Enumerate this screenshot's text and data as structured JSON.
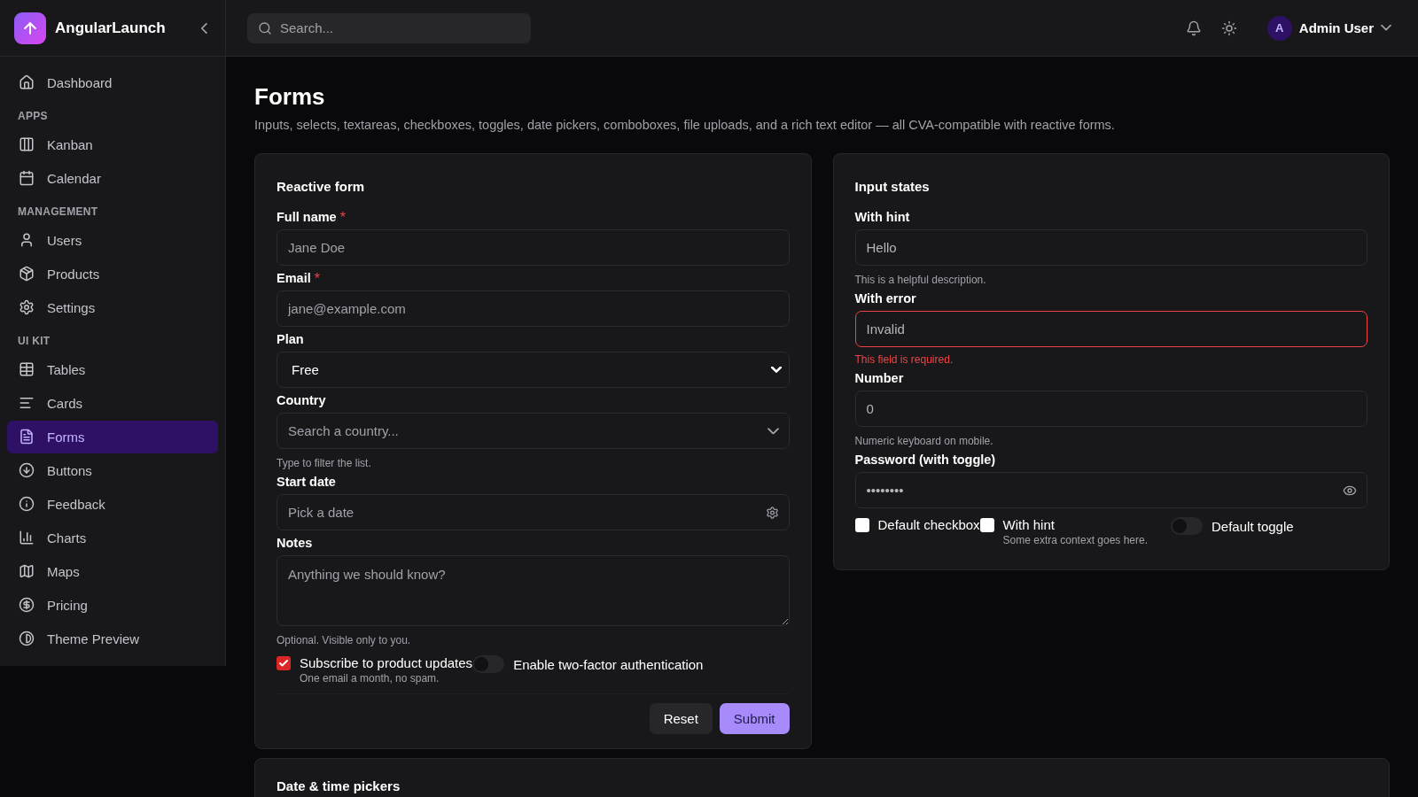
{
  "brand": {
    "name": "AngularLaunch"
  },
  "sidebar": {
    "sections": [
      {
        "items": [
          {
            "label": "Dashboard",
            "selected": false
          }
        ]
      },
      {
        "heading": "APPS",
        "items": [
          {
            "label": "Kanban",
            "selected": false
          },
          {
            "label": "Calendar",
            "selected": false
          }
        ]
      },
      {
        "heading": "MANAGEMENT",
        "items": [
          {
            "label": "Users",
            "selected": false
          },
          {
            "label": "Products",
            "selected": false
          },
          {
            "label": "Settings",
            "selected": false
          }
        ]
      },
      {
        "heading": "UI KIT",
        "items": [
          {
            "label": "Tables",
            "selected": false
          },
          {
            "label": "Cards",
            "selected": false
          },
          {
            "label": "Forms",
            "selected": true
          },
          {
            "label": "Buttons",
            "selected": false
          },
          {
            "label": "Feedback",
            "selected": false
          },
          {
            "label": "Charts",
            "selected": false
          },
          {
            "label": "Maps",
            "selected": false
          },
          {
            "label": "Pricing",
            "selected": false
          },
          {
            "label": "Theme Preview",
            "selected": false
          }
        ]
      }
    ]
  },
  "header": {
    "search": {
      "placeholder": "Search..."
    },
    "user": {
      "initial": "A",
      "name": "Admin User"
    }
  },
  "page": {
    "title": "Forms",
    "description": "Inputs, selects, textareas, checkboxes, toggles, date pickers, comboboxes, file uploads, and a rich text editor — all CVA-compatible with reactive forms."
  },
  "reactive_form": {
    "title": "Reactive form",
    "fields": [
      {
        "kind": "text",
        "label": "Full name",
        "required_mark": "*",
        "placeholder": "Jane Doe"
      },
      {
        "kind": "text",
        "label": "Email",
        "required_mark": "*",
        "placeholder": "jane@example.com"
      },
      {
        "kind": "select",
        "label": "Plan",
        "value": "Free"
      },
      {
        "kind": "combobox",
        "label": "Country",
        "placeholder": "Search a country...",
        "hint": "Type to filter the list."
      },
      {
        "kind": "date",
        "label": "Start date",
        "placeholder": "Pick a date"
      },
      {
        "kind": "textarea",
        "label": "Notes",
        "placeholder": "Anything we should know?",
        "hint": "Optional. Visible only to you."
      }
    ],
    "options": [
      {
        "kind": "checkbox",
        "label": "Subscribe to product updates",
        "checked": true,
        "hint": "One email a month, no spam."
      },
      {
        "kind": "toggle",
        "label": "Enable two-factor authentication",
        "on": false
      }
    ],
    "buttons": [
      {
        "kind": "secondary",
        "label": "Reset"
      },
      {
        "kind": "primary",
        "label": "Submit"
      }
    ]
  },
  "input_states": {
    "title": "Input states",
    "fields": [
      {
        "kind": "text",
        "label": "With hint",
        "value": "Hello",
        "hint": "This is a helpful description."
      },
      {
        "kind": "text",
        "label": "With error",
        "value": "Invalid",
        "error": "This field is required."
      },
      {
        "kind": "text",
        "label": "Number",
        "value": "0",
        "hint": "Numeric keyboard on mobile."
      },
      {
        "kind": "password",
        "label": "Password (with toggle)",
        "value": "••••••••"
      }
    ],
    "options": [
      {
        "kind": "checkbox",
        "label": "Default checkbox",
        "checked": false
      },
      {
        "kind": "checkbox",
        "label": "With hint",
        "checked": false,
        "hint": "Some extra context goes here."
      },
      {
        "kind": "toggle",
        "label": "Default toggle",
        "on": false
      }
    ]
  },
  "next_card": {
    "title": "Date & time pickers"
  }
}
